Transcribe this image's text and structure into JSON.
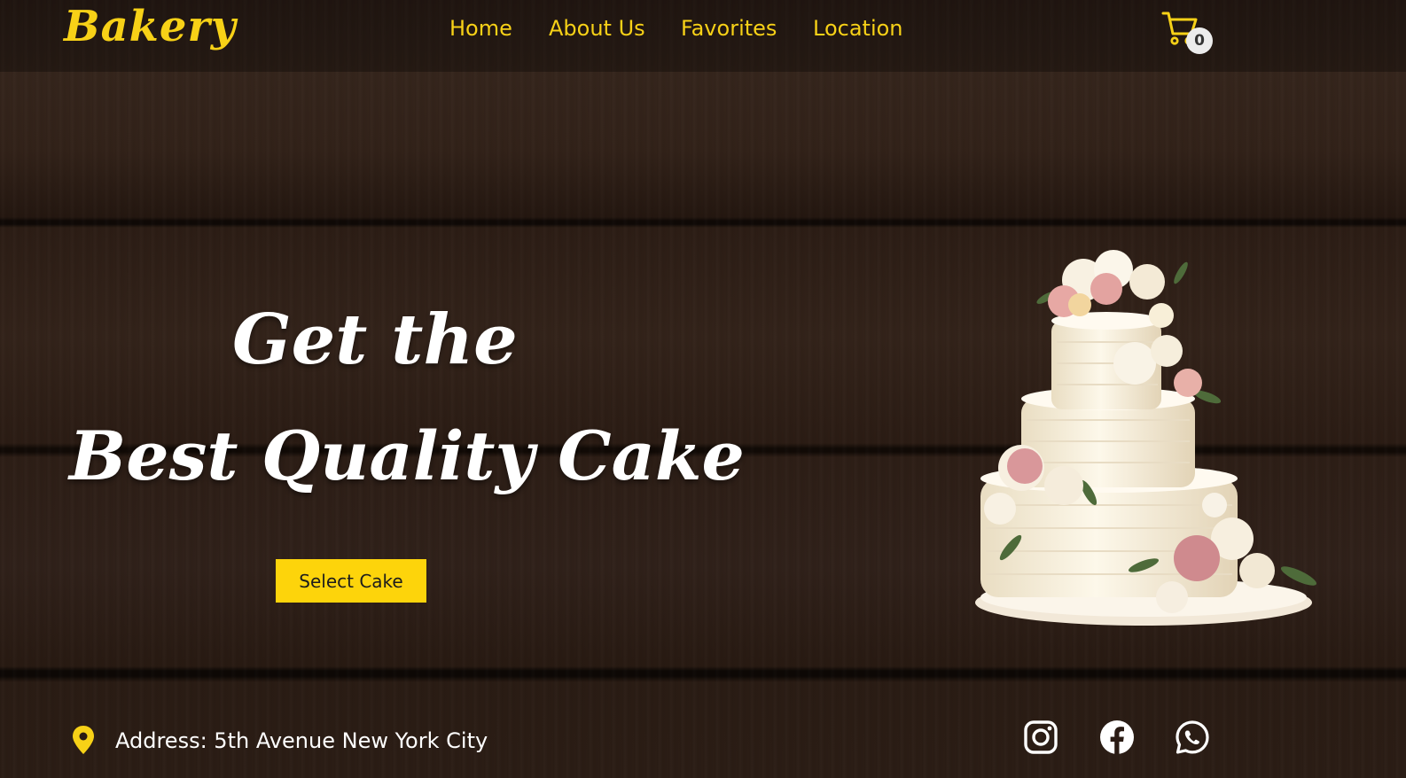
{
  "brand": {
    "logo_text": "Bakery"
  },
  "nav": {
    "items": [
      {
        "label": "Home"
      },
      {
        "label": "About Us"
      },
      {
        "label": "Favorites"
      },
      {
        "label": "Location"
      }
    ]
  },
  "cart": {
    "icon": "shopping-cart-icon",
    "count": "0"
  },
  "hero": {
    "line1": "Get the",
    "line2": "Best Quality Cake",
    "button_label": "Select Cake",
    "image": "three-tier-cake-with-flowers"
  },
  "footer": {
    "address_icon": "location-pin-icon",
    "address": "Address: 5th Avenue New York City",
    "social": [
      {
        "icon": "instagram-icon"
      },
      {
        "icon": "facebook-icon"
      },
      {
        "icon": "whatsapp-icon"
      }
    ]
  },
  "colors": {
    "accent": "#f7d117",
    "button": "#fdd40b",
    "text_light": "#ffffff",
    "wood": "#2a1b14"
  }
}
